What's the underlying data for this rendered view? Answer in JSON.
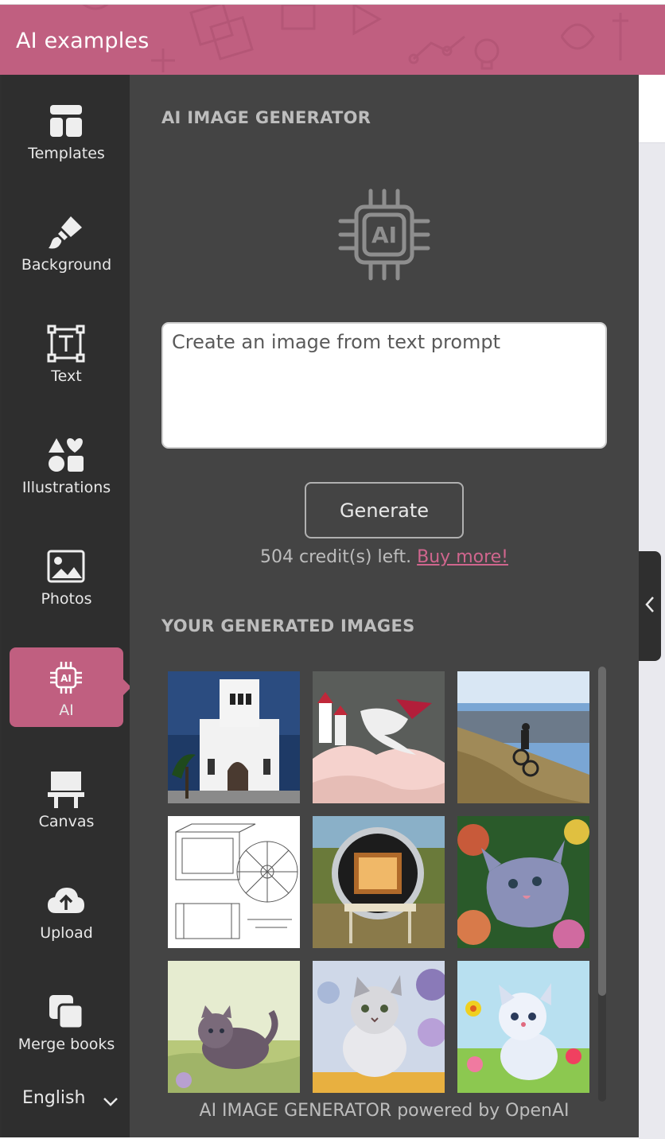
{
  "header": {
    "title": "AI examples"
  },
  "sidebar": {
    "items": [
      {
        "label": "Templates",
        "icon": "templates-icon"
      },
      {
        "label": "Background",
        "icon": "brush-icon"
      },
      {
        "label": "Text",
        "icon": "text-icon"
      },
      {
        "label": "Illustrations",
        "icon": "shapes-icon"
      },
      {
        "label": "Photos",
        "icon": "photo-icon"
      },
      {
        "label": "AI",
        "icon": "ai-chip-icon",
        "active": true
      },
      {
        "label": "Canvas",
        "icon": "easel-icon"
      },
      {
        "label": "Upload",
        "icon": "cloud-upload-icon"
      },
      {
        "label": "Merge books",
        "icon": "merge-icon"
      }
    ],
    "language": "English"
  },
  "panel": {
    "title": "AI IMAGE GENERATOR",
    "prompt_placeholder": "Create an image from text prompt",
    "generate_label": "Generate",
    "credits_text": "504 credit(s) left.",
    "buy_more_label": "Buy more!",
    "generated_title": "YOUR GENERATED IMAGES",
    "images": [
      "church",
      "castle-dragon",
      "cyclist-hill",
      "technical-sketch",
      "solar-oven",
      "kitten-flowers",
      "cat-meadow",
      "kitten-watercolor",
      "cartoon-kitten"
    ],
    "footer": "AI IMAGE GENERATOR powered by OpenAI"
  },
  "colors": {
    "accent": "#c05f80",
    "sidebar": "#2e2e2e",
    "panel": "#444444",
    "link": "#d0668e"
  }
}
